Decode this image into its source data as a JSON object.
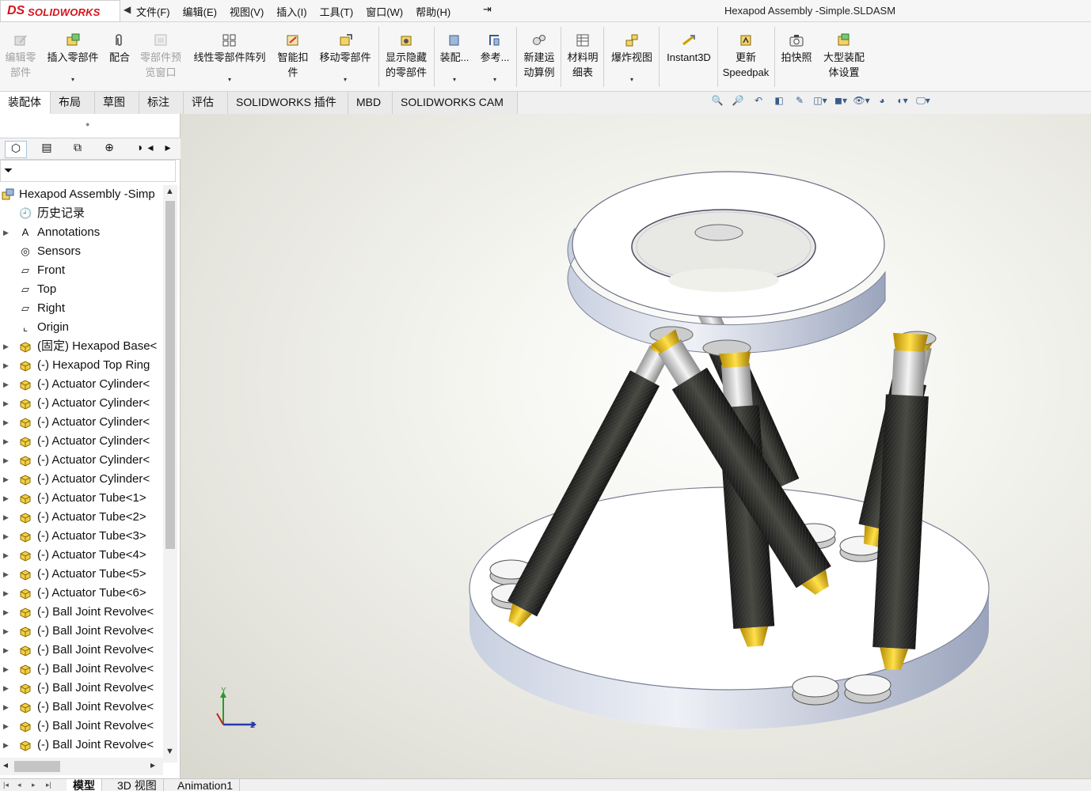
{
  "app": {
    "logo_ds": "DS",
    "logo_text": "SOLIDWORKS",
    "window_title": "Hexapod Assembly -Simple.SLDASM"
  },
  "menu": [
    "文件(F)",
    "编辑(E)",
    "视图(V)",
    "插入(I)",
    "工具(T)",
    "窗口(W)",
    "帮助(H)"
  ],
  "toolbar": {
    "edit_component": [
      "编辑零",
      "部件"
    ],
    "insert_component": "插入零部件",
    "mate": "配合",
    "component_preview": [
      "零部件预",
      "览窗口"
    ],
    "linear_pattern": "线性零部件阵列",
    "smart_fasteners": [
      "智能扣",
      "件"
    ],
    "move_component": "移动零部件",
    "show_hidden": [
      "显示隐藏",
      "的零部件"
    ],
    "assembly": "装配...",
    "reference": "参考...",
    "new_motion_study": [
      "新建运",
      "动算例"
    ],
    "bom": [
      "材料明",
      "细表"
    ],
    "exploded_view": "爆炸视图",
    "instant3d": "Instant3D",
    "update_speedpak": [
      "更新",
      "Speedpak"
    ],
    "snapshot": "拍快照",
    "large_assembly": [
      "大型装配",
      "体设置"
    ]
  },
  "command_tabs": [
    "装配体",
    "布局",
    "草图",
    "标注",
    "评估",
    "SOLIDWORKS 插件",
    "MBD",
    "SOLIDWORKS CAM"
  ],
  "tree": {
    "root": "Hexapod Assembly -Simp",
    "items": [
      {
        "label": "历史记录",
        "icon": "history-icon",
        "expandable": false
      },
      {
        "label": "Annotations",
        "icon": "annotations-icon",
        "expandable": true
      },
      {
        "label": "Sensors",
        "icon": "sensors-icon",
        "expandable": false
      },
      {
        "label": "Front",
        "icon": "plane-icon",
        "expandable": false
      },
      {
        "label": "Top",
        "icon": "plane-icon",
        "expandable": false
      },
      {
        "label": "Right",
        "icon": "plane-icon",
        "expandable": false
      },
      {
        "label": "Origin",
        "icon": "origin-icon",
        "expandable": false
      },
      {
        "label": "(固定) Hexapod Base<",
        "icon": "part-icon",
        "expandable": true
      },
      {
        "label": "(-) Hexapod Top Ring",
        "icon": "part-icon",
        "expandable": true
      },
      {
        "label": "(-) Actuator Cylinder<",
        "icon": "part-icon",
        "expandable": true
      },
      {
        "label": "(-) Actuator Cylinder<",
        "icon": "part-icon",
        "expandable": true
      },
      {
        "label": "(-) Actuator Cylinder<",
        "icon": "part-icon",
        "expandable": true
      },
      {
        "label": "(-) Actuator Cylinder<",
        "icon": "part-icon",
        "expandable": true
      },
      {
        "label": "(-) Actuator Cylinder<",
        "icon": "part-icon",
        "expandable": true
      },
      {
        "label": "(-) Actuator Cylinder<",
        "icon": "part-icon",
        "expandable": true
      },
      {
        "label": "(-) Actuator Tube<1>",
        "icon": "part-icon",
        "expandable": true
      },
      {
        "label": "(-) Actuator Tube<2>",
        "icon": "part-icon",
        "expandable": true
      },
      {
        "label": "(-) Actuator Tube<3>",
        "icon": "part-icon",
        "expandable": true
      },
      {
        "label": "(-) Actuator Tube<4>",
        "icon": "part-icon",
        "expandable": true
      },
      {
        "label": "(-) Actuator Tube<5>",
        "icon": "part-icon",
        "expandable": true
      },
      {
        "label": "(-) Actuator Tube<6>",
        "icon": "part-icon",
        "expandable": true
      },
      {
        "label": "(-) Ball Joint Revolve<",
        "icon": "part-icon",
        "expandable": true
      },
      {
        "label": "(-) Ball Joint Revolve<",
        "icon": "part-icon",
        "expandable": true
      },
      {
        "label": "(-) Ball Joint Revolve<",
        "icon": "part-icon",
        "expandable": true
      },
      {
        "label": "(-) Ball Joint Revolve<",
        "icon": "part-icon",
        "expandable": true
      },
      {
        "label": "(-) Ball Joint Revolve<",
        "icon": "part-icon",
        "expandable": true
      },
      {
        "label": "(-) Ball Joint Revolve<",
        "icon": "part-icon",
        "expandable": true
      },
      {
        "label": "(-) Ball Joint Revolve<",
        "icon": "part-icon",
        "expandable": true
      },
      {
        "label": "(-) Ball Joint Revolve<",
        "icon": "part-icon",
        "expandable": true
      }
    ]
  },
  "triad": {
    "y": "Y",
    "z": "Z"
  },
  "bottom_tabs": [
    "模型",
    "3D 视图",
    "Animation1"
  ],
  "colors": {
    "brand": "#d5141c",
    "accent": "#3a5c8c",
    "gold": "#e8b800"
  }
}
